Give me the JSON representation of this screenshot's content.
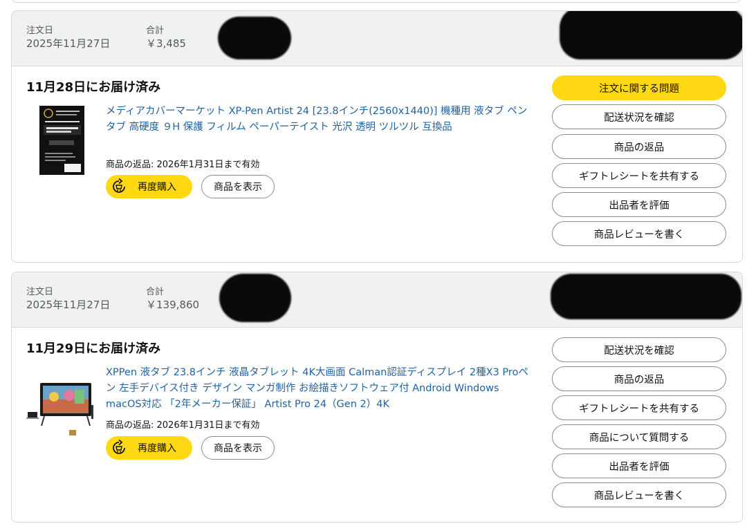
{
  "orders": [
    {
      "header": {
        "order_date_label": "注文日",
        "order_date": "2025年11月27日",
        "total_label": "合計",
        "total": "￥3,485"
      },
      "status": "11月28日にお届け済み",
      "product": {
        "title": "メディアカバーマーケット XP-Pen Artist 24 [23.8インチ(2560x1440)] 機種用 液タブ ペンタブ 高硬度 ９H 保護 フィルム ペーパーテイスト 光沢 透明 ツルツル 互換品",
        "return_note": "商品の返品: 2026年1月31日まで有効",
        "buy_again_label": "再度購入",
        "view_item_label": "商品を表示"
      },
      "actions": [
        "注文に関する問題",
        "配送状況を確認",
        "商品の返品",
        "ギフトレシートを共有する",
        "出品者を評価",
        "商品レビューを書く"
      ]
    },
    {
      "header": {
        "order_date_label": "注文日",
        "order_date": "2025年11月27日",
        "total_label": "合計",
        "total": "￥139,860"
      },
      "status": "11月29日にお届け済み",
      "product": {
        "title": "XPPen 液タブ 23.8インチ 液晶タブレット 4K大画面 Calman認証ディスプレイ 2種X3 Proペン 左手デバイス付き デザイン マンガ制作 お絵描きソフトウェア付 Android Windows macOS対応 「2年メーカー保証」 Artist Pro 24（Gen 2）4K",
        "return_note": "商品の返品: 2026年1月31日まで有効",
        "buy_again_label": "再度購入",
        "view_item_label": "商品を表示"
      },
      "actions": [
        "配送状況を確認",
        "商品の返品",
        "ギフトレシートを共有する",
        "商品について質問する",
        "出品者を評価",
        "商品レビューを書く"
      ]
    }
  ],
  "colors": {
    "accent_yellow": "#ffd814",
    "link_blue": "#2162a1",
    "header_gray": "#f0f2f2"
  },
  "icons": {
    "buy_again": "repeat-cart-icon"
  }
}
